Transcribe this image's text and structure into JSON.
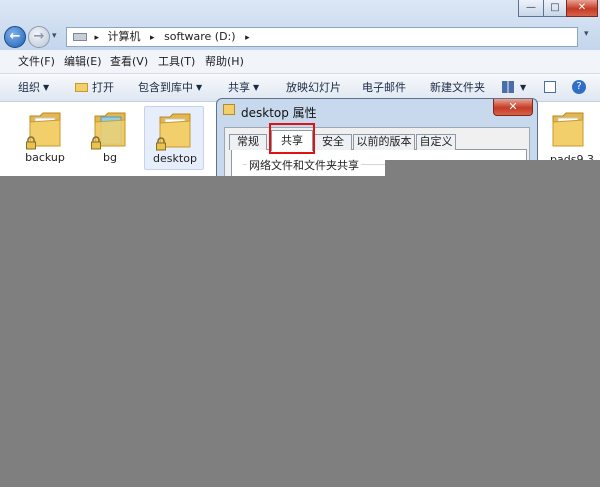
{
  "window": {
    "minimize": "—",
    "maximize": "□",
    "close": "✕"
  },
  "nav": {
    "back_icon": "←",
    "forward_icon": "→",
    "dropdown_icon": "▾"
  },
  "address": {
    "sep": "▸",
    "computer": "计算机",
    "drive": "software (D:)",
    "dropdown": "▾",
    "refresh": "⟳"
  },
  "menu": [
    "文件(F)",
    "编辑(E)",
    "查看(V)",
    "工具(T)",
    "帮助(H)"
  ],
  "toolbar": {
    "organize": "组织",
    "open": "打开",
    "include": "包含到库中",
    "share": "共享",
    "slideshow": "放映幻灯片",
    "email": "电子邮件",
    "new_folder": "新建文件夹",
    "arrow": "▼"
  },
  "folders": [
    {
      "name": "backup",
      "locked": true
    },
    {
      "name": "bg",
      "locked": true
    },
    {
      "name": "desktop",
      "locked": true
    },
    {
      "name": "pads9.3",
      "locked": false
    }
  ],
  "dialog": {
    "title": "desktop 属性",
    "close": "✕",
    "tabs": [
      "常规",
      "共享",
      "安全",
      "以前的版本",
      "自定义"
    ],
    "active_tab": "共享",
    "group_label": "网络文件和文件夹共享"
  },
  "colors": {
    "overlay": "#7f7f7f",
    "highlight": "#e01313",
    "folder": "#f3cf6b"
  }
}
